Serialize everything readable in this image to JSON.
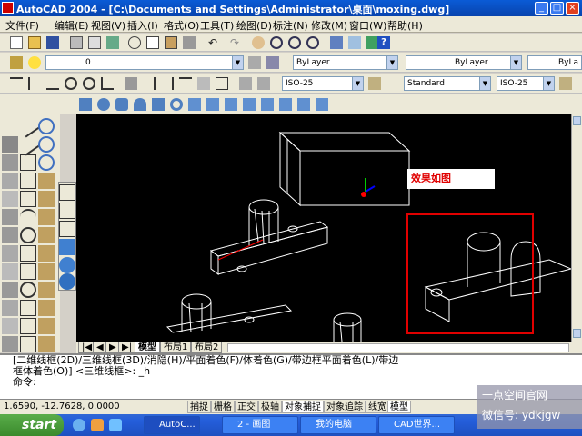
{
  "window": {
    "title": "AutoCAD 2004 - [C:\\Documents and Settings\\Administrator\\桌面\\moxing.dwg]",
    "controls": [
      "_",
      "□",
      "×"
    ]
  },
  "menu": {
    "items": [
      "文件(F)",
      "编辑(E)",
      "视图(V)",
      "插入(I)",
      "格式(O)",
      "工具(T)",
      "绘图(D)",
      "标注(N)",
      "修改(M)",
      "窗口(W)",
      "帮助(H)"
    ]
  },
  "layers": {
    "current_layer": "0",
    "color": "ByLayer",
    "linetype": "ByLayer",
    "lineweight": "ByLa"
  },
  "styles": {
    "dim_style": "ISO-25",
    "text_style": "Standard",
    "table_style": "ISO-25"
  },
  "drawing": {
    "annotation": "效果如图",
    "colors": {
      "background": "#000000",
      "lines": "#ffffff",
      "highlight": "#ff0000"
    }
  },
  "tabs": {
    "nav": [
      "|◀",
      "◀",
      "▶",
      "▶|"
    ],
    "items": [
      "模型",
      "布局1",
      "布局2"
    ],
    "active": "模型"
  },
  "command": {
    "lines": [
      "[二维线框(2D)/三维线框(3D)/消隐(H)/平面着色(F)/体着色(G)/带边框平面着色(L)/带边",
      "框体着色(O)] <三维线框>: _h",
      "命令:"
    ]
  },
  "status": {
    "coords": "1.6590,  -12.7628, 0.0000",
    "buttons": [
      "捕捉",
      "栅格",
      "正交",
      "极轴",
      "对象捕捉",
      "对象追踪",
      "线宽",
      "模型"
    ]
  },
  "taskbar": {
    "start": "start",
    "items": [
      "AutoC...",
      "2 - 画图",
      "我的电脑",
      "CAD世界..."
    ]
  },
  "watermark": {
    "line1": "一点空间官网",
    "line2": "微信号: ydkjgw"
  }
}
